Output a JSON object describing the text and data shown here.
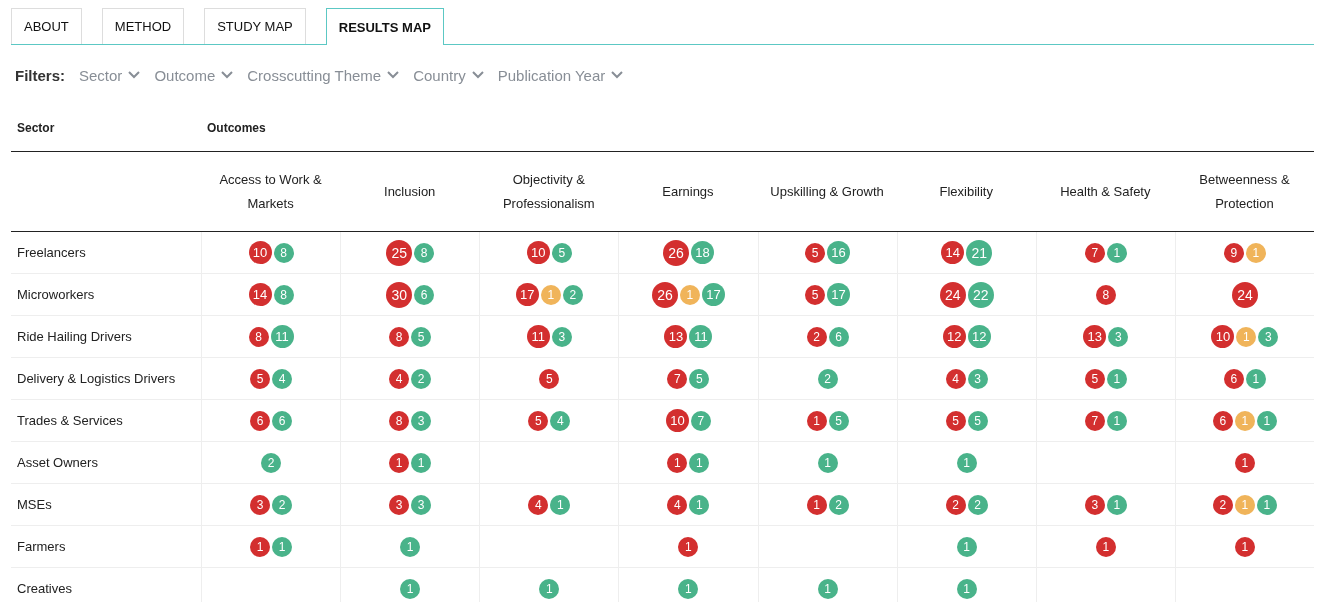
{
  "tabs": [
    {
      "label": "ABOUT",
      "selected": false
    },
    {
      "label": "METHOD",
      "selected": false
    },
    {
      "label": "STUDY MAP",
      "selected": false
    },
    {
      "label": "RESULTS MAP",
      "selected": true
    }
  ],
  "filters": {
    "label": "Filters:",
    "items": [
      "Sector",
      "Outcome",
      "Crosscutting Theme",
      "Country",
      "Publication Year"
    ]
  },
  "table": {
    "sector_heading": "Sector",
    "outcomes_heading": "Outcomes",
    "columns": [
      "Access to Work & Markets",
      "Inclusion",
      "Objectivity & Professionalism",
      "Earnings",
      "Upskilling & Growth",
      "Flexibility",
      "Health & Safety",
      "Betweenness & Protection"
    ],
    "rows": [
      {
        "sector": "Freelancers",
        "cells": [
          [
            {
              "kind": "negative",
              "count": "10"
            },
            {
              "kind": "positive",
              "count": "8"
            }
          ],
          [
            {
              "kind": "negative",
              "count": "25"
            },
            {
              "kind": "positive",
              "count": "8"
            }
          ],
          [
            {
              "kind": "negative",
              "count": "10"
            },
            {
              "kind": "positive",
              "count": "5"
            }
          ],
          [
            {
              "kind": "negative",
              "count": "26"
            },
            {
              "kind": "positive",
              "count": "18"
            }
          ],
          [
            {
              "kind": "negative",
              "count": "5"
            },
            {
              "kind": "positive",
              "count": "16"
            }
          ],
          [
            {
              "kind": "negative",
              "count": "14"
            },
            {
              "kind": "positive",
              "count": "21"
            }
          ],
          [
            {
              "kind": "negative",
              "count": "7"
            },
            {
              "kind": "positive",
              "count": "1"
            }
          ],
          [
            {
              "kind": "negative",
              "count": "9"
            },
            {
              "kind": "mixed",
              "count": "1"
            }
          ]
        ]
      },
      {
        "sector": "Microworkers",
        "cells": [
          [
            {
              "kind": "negative",
              "count": "14"
            },
            {
              "kind": "positive",
              "count": "8"
            }
          ],
          [
            {
              "kind": "negative",
              "count": "30"
            },
            {
              "kind": "positive",
              "count": "6"
            }
          ],
          [
            {
              "kind": "negative",
              "count": "17"
            },
            {
              "kind": "mixed",
              "count": "1"
            },
            {
              "kind": "positive",
              "count": "2"
            }
          ],
          [
            {
              "kind": "negative",
              "count": "26"
            },
            {
              "kind": "mixed",
              "count": "1"
            },
            {
              "kind": "positive",
              "count": "17"
            }
          ],
          [
            {
              "kind": "negative",
              "count": "5"
            },
            {
              "kind": "positive",
              "count": "17"
            }
          ],
          [
            {
              "kind": "negative",
              "count": "24"
            },
            {
              "kind": "positive",
              "count": "22"
            }
          ],
          [
            {
              "kind": "negative",
              "count": "8"
            }
          ],
          [
            {
              "kind": "negative",
              "count": "24"
            }
          ]
        ]
      },
      {
        "sector": "Ride Hailing Drivers",
        "cells": [
          [
            {
              "kind": "negative",
              "count": "8"
            },
            {
              "kind": "positive",
              "count": "11"
            }
          ],
          [
            {
              "kind": "negative",
              "count": "8"
            },
            {
              "kind": "positive",
              "count": "5"
            }
          ],
          [
            {
              "kind": "negative",
              "count": "11"
            },
            {
              "kind": "positive",
              "count": "3"
            }
          ],
          [
            {
              "kind": "negative",
              "count": "13"
            },
            {
              "kind": "positive",
              "count": "11"
            }
          ],
          [
            {
              "kind": "negative",
              "count": "2"
            },
            {
              "kind": "positive",
              "count": "6"
            }
          ],
          [
            {
              "kind": "negative",
              "count": "12"
            },
            {
              "kind": "positive",
              "count": "12"
            }
          ],
          [
            {
              "kind": "negative",
              "count": "13"
            },
            {
              "kind": "positive",
              "count": "3"
            }
          ],
          [
            {
              "kind": "negative",
              "count": "10"
            },
            {
              "kind": "mixed",
              "count": "1"
            },
            {
              "kind": "positive",
              "count": "3"
            }
          ]
        ]
      },
      {
        "sector": "Delivery & Logistics Drivers",
        "cells": [
          [
            {
              "kind": "negative",
              "count": "5"
            },
            {
              "kind": "positive",
              "count": "4"
            }
          ],
          [
            {
              "kind": "negative",
              "count": "4"
            },
            {
              "kind": "positive",
              "count": "2"
            }
          ],
          [
            {
              "kind": "negative",
              "count": "5"
            }
          ],
          [
            {
              "kind": "negative",
              "count": "7"
            },
            {
              "kind": "positive",
              "count": "5"
            }
          ],
          [
            {
              "kind": "positive",
              "count": "2"
            }
          ],
          [
            {
              "kind": "negative",
              "count": "4"
            },
            {
              "kind": "positive",
              "count": "3"
            }
          ],
          [
            {
              "kind": "negative",
              "count": "5"
            },
            {
              "kind": "positive",
              "count": "1"
            }
          ],
          [
            {
              "kind": "negative",
              "count": "6"
            },
            {
              "kind": "positive",
              "count": "1"
            }
          ]
        ]
      },
      {
        "sector": "Trades & Services",
        "cells": [
          [
            {
              "kind": "negative",
              "count": "6"
            },
            {
              "kind": "positive",
              "count": "6"
            }
          ],
          [
            {
              "kind": "negative",
              "count": "8"
            },
            {
              "kind": "positive",
              "count": "3"
            }
          ],
          [
            {
              "kind": "negative",
              "count": "5"
            },
            {
              "kind": "positive",
              "count": "4"
            }
          ],
          [
            {
              "kind": "negative",
              "count": "10"
            },
            {
              "kind": "positive",
              "count": "7"
            }
          ],
          [
            {
              "kind": "negative",
              "count": "1"
            },
            {
              "kind": "positive",
              "count": "5"
            }
          ],
          [
            {
              "kind": "negative",
              "count": "5"
            },
            {
              "kind": "positive",
              "count": "5"
            }
          ],
          [
            {
              "kind": "negative",
              "count": "7"
            },
            {
              "kind": "positive",
              "count": "1"
            }
          ],
          [
            {
              "kind": "negative",
              "count": "6"
            },
            {
              "kind": "mixed",
              "count": "1"
            },
            {
              "kind": "positive",
              "count": "1"
            }
          ]
        ]
      },
      {
        "sector": "Asset Owners",
        "cells": [
          [
            {
              "kind": "positive",
              "count": "2"
            }
          ],
          [
            {
              "kind": "negative",
              "count": "1"
            },
            {
              "kind": "positive",
              "count": "1"
            }
          ],
          [],
          [
            {
              "kind": "negative",
              "count": "1"
            },
            {
              "kind": "positive",
              "count": "1"
            }
          ],
          [
            {
              "kind": "positive",
              "count": "1"
            }
          ],
          [
            {
              "kind": "positive",
              "count": "1"
            }
          ],
          [],
          [
            {
              "kind": "negative",
              "count": "1"
            }
          ]
        ]
      },
      {
        "sector": "MSEs",
        "cells": [
          [
            {
              "kind": "negative",
              "count": "3"
            },
            {
              "kind": "positive",
              "count": "2"
            }
          ],
          [
            {
              "kind": "negative",
              "count": "3"
            },
            {
              "kind": "positive",
              "count": "3"
            }
          ],
          [
            {
              "kind": "negative",
              "count": "4"
            },
            {
              "kind": "positive",
              "count": "1"
            }
          ],
          [
            {
              "kind": "negative",
              "count": "4"
            },
            {
              "kind": "positive",
              "count": "1"
            }
          ],
          [
            {
              "kind": "negative",
              "count": "1"
            },
            {
              "kind": "positive",
              "count": "2"
            }
          ],
          [
            {
              "kind": "negative",
              "count": "2"
            },
            {
              "kind": "positive",
              "count": "2"
            }
          ],
          [
            {
              "kind": "negative",
              "count": "3"
            },
            {
              "kind": "positive",
              "count": "1"
            }
          ],
          [
            {
              "kind": "negative",
              "count": "2"
            },
            {
              "kind": "mixed",
              "count": "1"
            },
            {
              "kind": "positive",
              "count": "1"
            }
          ]
        ]
      },
      {
        "sector": "Farmers",
        "cells": [
          [
            {
              "kind": "negative",
              "count": "1"
            },
            {
              "kind": "positive",
              "count": "1"
            }
          ],
          [
            {
              "kind": "positive",
              "count": "1"
            }
          ],
          [],
          [
            {
              "kind": "negative",
              "count": "1"
            }
          ],
          [],
          [
            {
              "kind": "positive",
              "count": "1"
            }
          ],
          [
            {
              "kind": "negative",
              "count": "1"
            }
          ],
          [
            {
              "kind": "negative",
              "count": "1"
            }
          ]
        ]
      },
      {
        "sector": "Creatives",
        "cells": [
          [],
          [
            {
              "kind": "positive",
              "count": "1"
            }
          ],
          [
            {
              "kind": "positive",
              "count": "1"
            }
          ],
          [
            {
              "kind": "positive",
              "count": "1"
            }
          ],
          [
            {
              "kind": "positive",
              "count": "1"
            }
          ],
          [
            {
              "kind": "positive",
              "count": "1"
            }
          ],
          [],
          []
        ]
      }
    ]
  }
}
